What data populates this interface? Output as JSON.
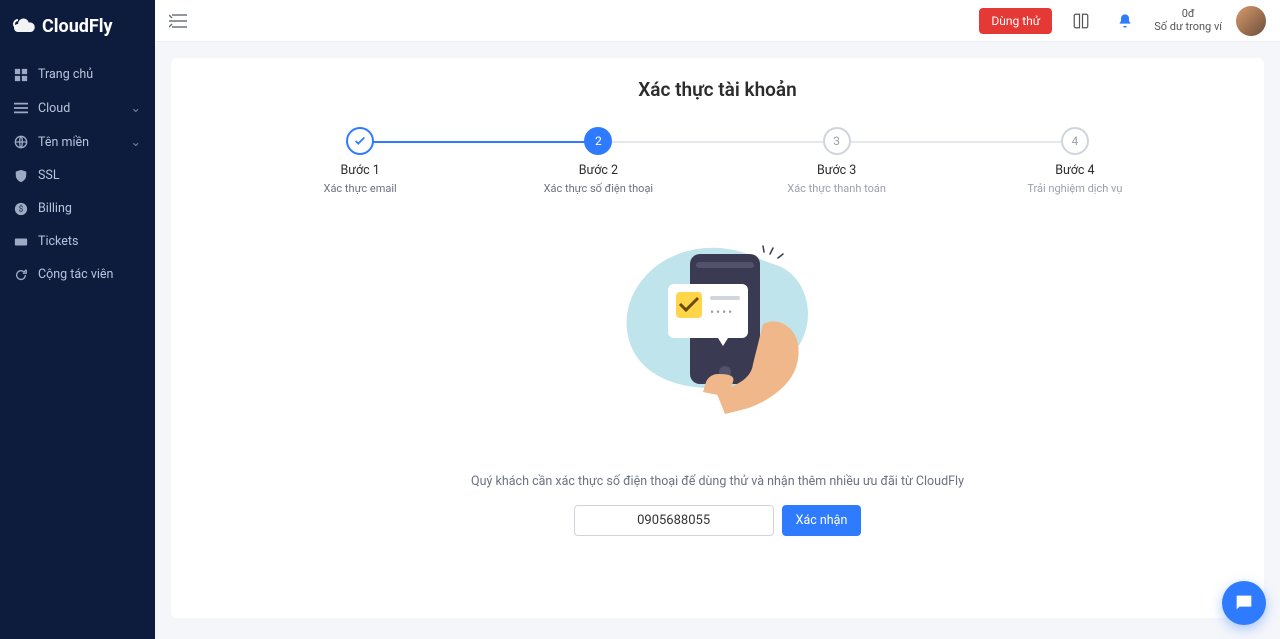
{
  "brand": "CloudFly",
  "sidebar": {
    "items": [
      {
        "label": "Trang chủ",
        "icon": "dashboard-icon",
        "expandable": false
      },
      {
        "label": "Cloud",
        "icon": "list-icon",
        "expandable": true
      },
      {
        "label": "Tên miền",
        "icon": "globe-icon",
        "expandable": true
      },
      {
        "label": "SSL",
        "icon": "shield-icon",
        "expandable": false
      },
      {
        "label": "Billing",
        "icon": "dollar-icon",
        "expandable": false
      },
      {
        "label": "Tickets",
        "icon": "ticket-icon",
        "expandable": false
      },
      {
        "label": "Cộng tác viên",
        "icon": "refresh-icon",
        "expandable": false
      }
    ]
  },
  "topbar": {
    "trial_button": "Dùng thử",
    "balance_amount": "0đ",
    "balance_label": "Số dư trong ví"
  },
  "page": {
    "title": "Xác thực tài khoản",
    "steps": [
      {
        "num": "✓",
        "label": "Bước 1",
        "sub": "Xác thực email",
        "state": "done"
      },
      {
        "num": "2",
        "label": "Bước 2",
        "sub": "Xác thực số điện thoại",
        "state": "active"
      },
      {
        "num": "3",
        "label": "Bước 3",
        "sub": "Xác thực thanh toán",
        "state": "pending"
      },
      {
        "num": "4",
        "label": "Bước 4",
        "sub": "Trải nghiệm dịch vụ",
        "state": "pending"
      }
    ],
    "description": "Quý khách cần xác thực số điện thoại để dùng thử và nhận thêm nhiều ưu đãi từ CloudFly",
    "phone_value": "0905688055",
    "confirm_button": "Xác nhận"
  }
}
